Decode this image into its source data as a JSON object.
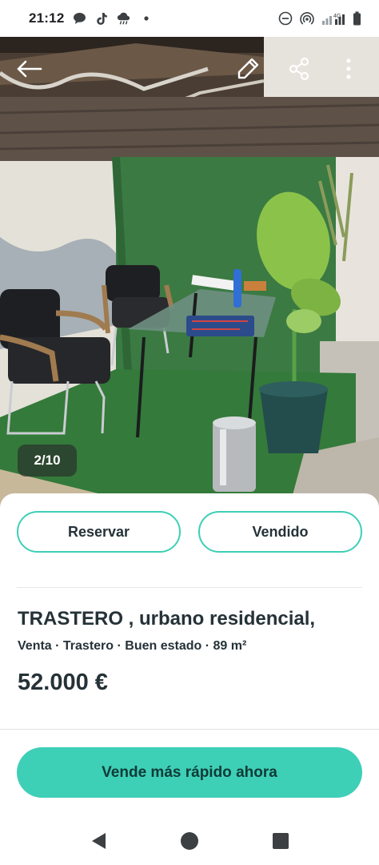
{
  "status_bar": {
    "time": "21:12",
    "left_icons": [
      "chat-bubble-icon",
      "tiktok-icon",
      "cloud-rain-icon",
      "dot-icon"
    ],
    "right_icons": [
      "do-not-disturb-icon",
      "hotspot-icon",
      "signal-icon",
      "network-4g-icon",
      "battery-icon"
    ],
    "network_label": "4G"
  },
  "photo": {
    "counter": "2/10",
    "top_actions": [
      "back-arrow-icon",
      "edit-pencil-icon",
      "share-icon",
      "more-vertical-icon"
    ]
  },
  "actions": {
    "reserve_label": "Reservar",
    "sold_label": "Vendido"
  },
  "listing": {
    "title": "TRASTERO , urbano residencial,",
    "meta": "Venta · Trastero · Buen estado · 89 m²",
    "price": "52.000 €"
  },
  "cta": {
    "label": "Vende más rápido ahora"
  },
  "colors": {
    "accent": "#3ecfb7",
    "text_primary": "#253238"
  },
  "nav_bar": {
    "icons": [
      "back-triangle-icon",
      "home-circle-icon",
      "recents-square-icon"
    ]
  }
}
